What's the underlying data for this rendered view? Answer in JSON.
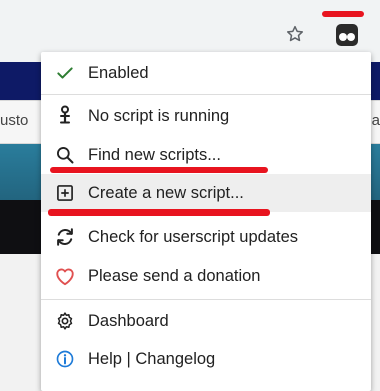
{
  "browser": {
    "bookmark_icon": "star-icon",
    "extension_icon": "tampermonkey-icon"
  },
  "page": {
    "left_tab_fragment": "usto",
    "right_tab_fragment": "ea"
  },
  "menu": {
    "items": [
      {
        "label": "Enabled",
        "icon": "checkmark-icon",
        "color": "#2e7d32"
      },
      {
        "label": "No script is running",
        "icon": "script-icon"
      },
      {
        "label": "Find new scripts...",
        "icon": "search-icon"
      },
      {
        "label": "Create a new script...",
        "icon": "add-box-icon"
      },
      {
        "label": "Check for userscript updates",
        "icon": "refresh-icon"
      },
      {
        "label": "Please send a donation",
        "icon": "heart-icon",
        "color": "#e05050"
      },
      {
        "label": "Dashboard",
        "icon": "gear-icon"
      },
      {
        "label": "Help | Changelog",
        "icon": "info-icon",
        "color": "#1e7bd8"
      }
    ]
  },
  "colors": {
    "annotation_red": "#e8141f",
    "background": "#0e1a66"
  }
}
